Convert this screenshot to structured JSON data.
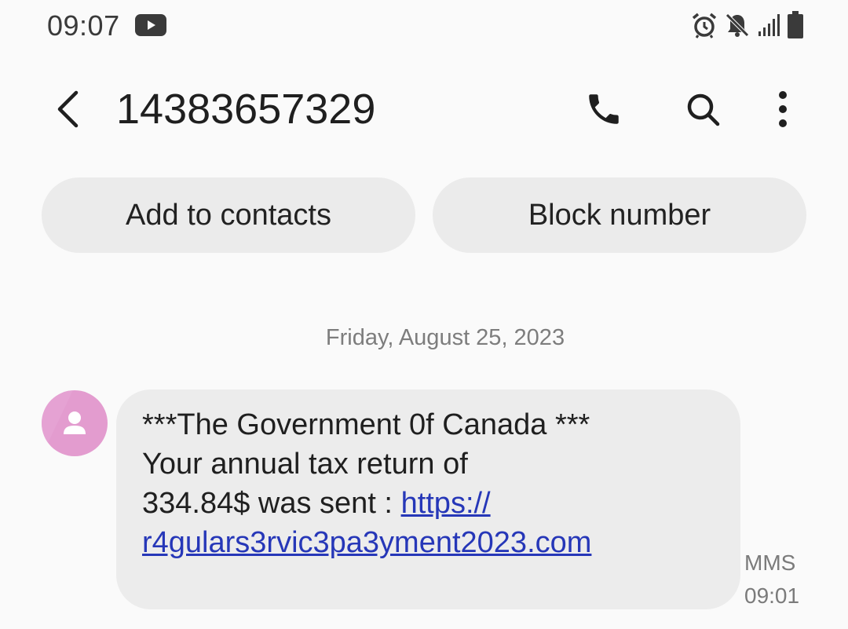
{
  "status_bar": {
    "time": "09:07",
    "icons": [
      "youtube-icon",
      "alarm-icon",
      "mute-icon",
      "signal-icon",
      "battery-icon"
    ]
  },
  "header": {
    "contact": "14383657329",
    "icons": [
      "back-icon",
      "phone-icon",
      "search-icon",
      "more-vert-icon"
    ]
  },
  "actions": {
    "add_contacts": "Add to contacts",
    "block_number": "Block number"
  },
  "conversation": {
    "date": "Friday, August 25, 2023",
    "message": {
      "line1": "***The Government 0f Canada ***",
      "line2": "Your annual tax return of",
      "line3_text": "334.84$ was sent : ",
      "line3_link": "https://",
      "line4_link": "r4gulars3rvic3pa3yment2023.com",
      "type": "MMS",
      "time": "09:01"
    }
  },
  "colors": {
    "background": "#fafafa",
    "bubble": "#ececec",
    "pill": "#ebebeb",
    "link": "#2637b8",
    "avatar": "#e39ccf"
  }
}
